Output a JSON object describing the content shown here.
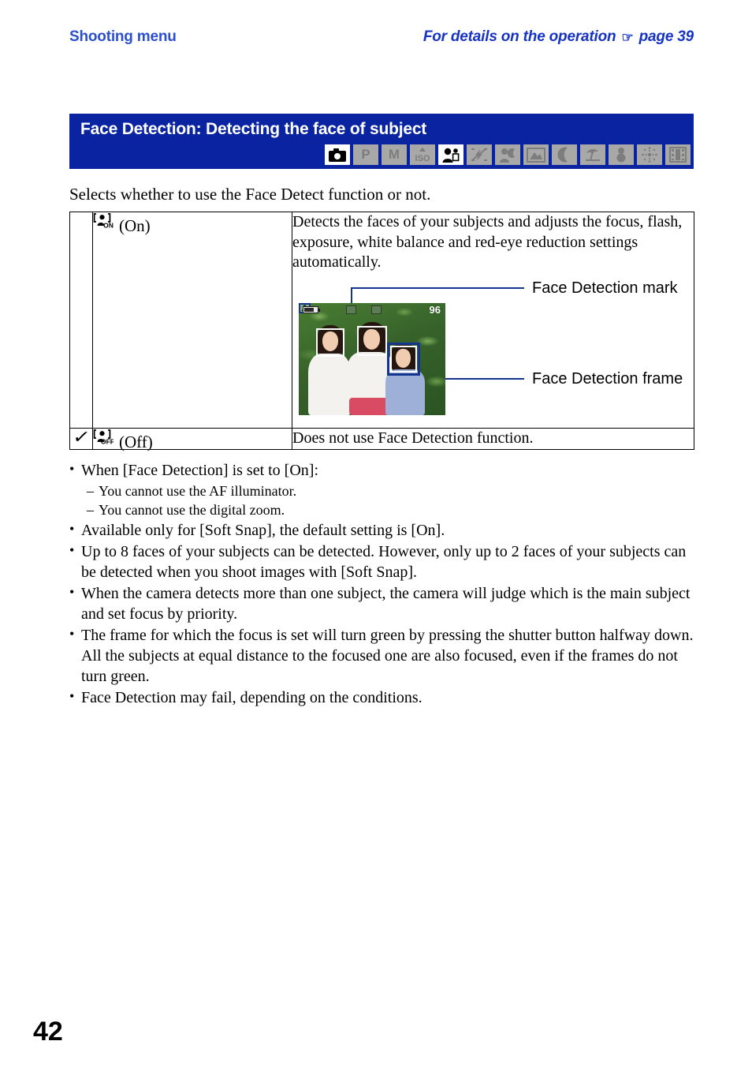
{
  "header": {
    "left_title": "Shooting menu",
    "right_title_before": "For details on the operation",
    "hand_icon": "☞",
    "right_title_after": "page 39",
    "accent_color": "#2b4fcf"
  },
  "title_band": {
    "title": "Face Detection: Detecting the face of subject",
    "background_color": "#0a23a0",
    "mode_icons": [
      {
        "name": "auto-camera-icon",
        "label": "",
        "active": true
      },
      {
        "name": "program-mode-icon",
        "label": "P",
        "active": false
      },
      {
        "name": "manual-mode-icon",
        "label": "M",
        "active": false
      },
      {
        "name": "high-sensitivity-iso-icon",
        "label": "ISO",
        "active": false
      },
      {
        "name": "soft-snap-icon",
        "label": "",
        "active": true
      },
      {
        "name": "no-flash-icon",
        "label": "",
        "active": false
      },
      {
        "name": "twilight-portrait-icon",
        "label": "",
        "active": false
      },
      {
        "name": "landscape-icon",
        "label": "",
        "active": false
      },
      {
        "name": "twilight-moon-icon",
        "label": "",
        "active": false
      },
      {
        "name": "beach-icon",
        "label": "",
        "active": false
      },
      {
        "name": "snow-icon",
        "label": "",
        "active": false
      },
      {
        "name": "fireworks-icon",
        "label": "",
        "active": false
      },
      {
        "name": "movie-mode-icon",
        "label": "",
        "active": false
      }
    ]
  },
  "intro": "Selects whether to use the Face Detect function or not.",
  "table": {
    "rows": [
      {
        "checked": false,
        "check_glyph": "",
        "icon_state": "ON",
        "label": "(On)",
        "description": "Detects the faces of your subjects and adjusts the focus, flash, exposure, white balance and red-eye reduction settings automatically."
      },
      {
        "checked": true,
        "check_glyph": "✓",
        "icon_state": "OFF",
        "label": "(Off)",
        "description": "Does not use Face Detection function."
      }
    ]
  },
  "illustration": {
    "callout_mark": "Face Detection mark",
    "callout_frame": "Face Detection frame",
    "shots_remaining": "96",
    "line_color": "#14368f",
    "frame_color": "#ffffff"
  },
  "notes": [
    {
      "text": "When [Face Detection] is set to [On]:",
      "subnotes": [
        "You cannot use the AF illuminator.",
        "You cannot use the digital zoom."
      ]
    },
    {
      "text": "Available only for [Soft Snap], the default setting is [On].",
      "subnotes": []
    },
    {
      "text": "Up to 8 faces of your subjects can be detected. However, only up to 2 faces of your subjects can be detected when you shoot images with [Soft Snap].",
      "subnotes": []
    },
    {
      "text": "When the camera detects more than one subject, the camera will judge which is the main subject and set focus by priority.",
      "subnotes": []
    },
    {
      "text": "The frame for which the focus is set will turn green by pressing the shutter button halfway down. All the subjects at equal distance to the focused one are also focused, even if the frames do not turn green.",
      "subnotes": []
    },
    {
      "text": "Face Detection may fail, depending on the conditions.",
      "subnotes": []
    }
  ],
  "bullet_char": "•",
  "dash_char": "–",
  "page_number": "42"
}
